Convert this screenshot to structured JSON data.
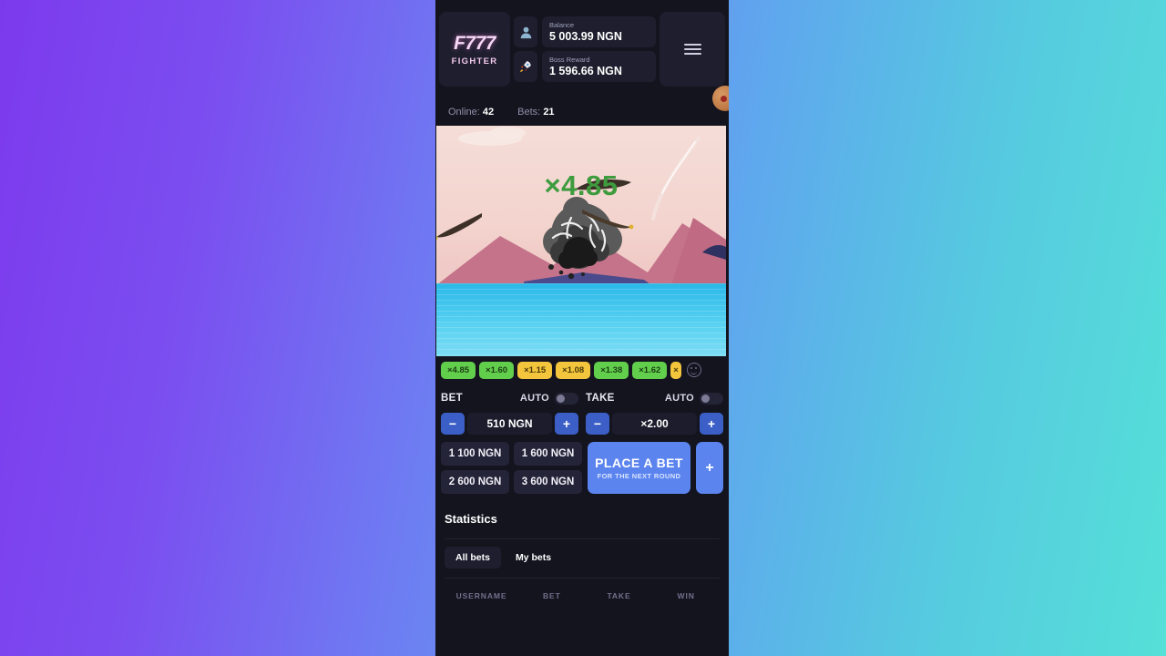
{
  "app": {
    "logo_main": "F777",
    "logo_sub": "FIGHTER",
    "menu_icon": "hamburger-menu-icon"
  },
  "header": {
    "balance": {
      "label": "Balance",
      "value": "5 003.99 NGN",
      "icon": "user-avatar-icon"
    },
    "boss_reward": {
      "label": "Boss Reward",
      "value": "1 596.66 NGN",
      "icon": "rocket-icon"
    }
  },
  "statusbar": {
    "online_label": "Online:",
    "online_value": "42",
    "bets_label": "Bets:",
    "bets_value": "21"
  },
  "game": {
    "multiplier": "×4.85",
    "multiplier_color": "#3e9b3e",
    "state": "crashed"
  },
  "history": {
    "chips": [
      {
        "label": "×4.85",
        "color": "green"
      },
      {
        "label": "×1.60",
        "color": "green"
      },
      {
        "label": "×1.15",
        "color": "yellow"
      },
      {
        "label": "×1.08",
        "color": "yellow"
      },
      {
        "label": "×1.38",
        "color": "green"
      },
      {
        "label": "×1.62",
        "color": "green"
      },
      {
        "label": "×",
        "color": "yellow"
      }
    ],
    "emoji_icon": "smiley-face-icon"
  },
  "controls": {
    "bet": {
      "title": "BET",
      "auto_label": "AUTO",
      "auto_on": false,
      "minus": "−",
      "plus": "+",
      "value": "510 NGN"
    },
    "take": {
      "title": "TAKE",
      "auto_label": "AUTO",
      "auto_on": false,
      "minus": "−",
      "plus": "+",
      "value": "×2.00"
    },
    "quick_bets": [
      "1 100 NGN",
      "1 600 NGN",
      "2 600 NGN",
      "3 600 NGN"
    ],
    "place_bet": {
      "main": "PLACE A BET",
      "sub": "FOR THE NEXT ROUND"
    },
    "add_bet_plus": "+"
  },
  "statistics": {
    "title": "Statistics",
    "tabs": [
      {
        "label": "All bets",
        "active": true
      },
      {
        "label": "My bets",
        "active": false
      }
    ],
    "columns": [
      "USERNAME",
      "BET",
      "TAKE",
      "WIN"
    ],
    "rows": []
  },
  "colors": {
    "accent_blue": "#5b84ef",
    "chip_green": "#62cf4c",
    "chip_yellow": "#f2c53d",
    "panel_bg": "#14141f",
    "surface": "#1e1e2e",
    "bg_gradient_start": "#7c3aed",
    "bg_gradient_end": "#55e0d8"
  }
}
